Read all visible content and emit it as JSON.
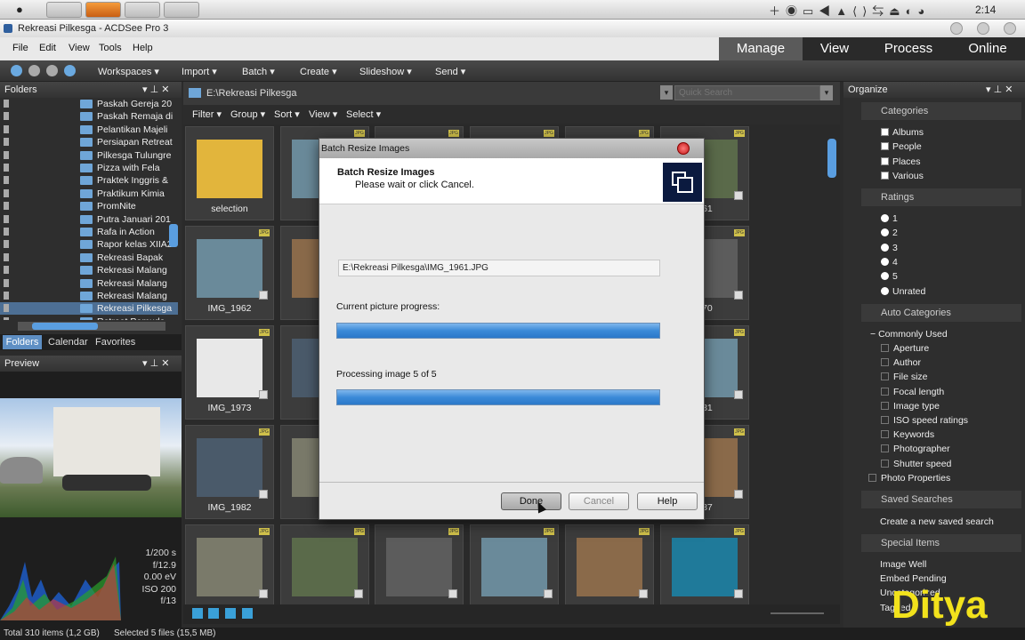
{
  "os": {
    "time": "2:14"
  },
  "window": {
    "title": "Rekreasi Pilkesga - ACDSee Pro 3"
  },
  "menu": [
    "File",
    "Edit",
    "View",
    "Tools",
    "Help"
  ],
  "modes": [
    "Manage",
    "View",
    "Process",
    "Online"
  ],
  "toolbar": [
    "Workspaces",
    "Import",
    "Batch",
    "Create",
    "Slideshow",
    "Send"
  ],
  "folders": {
    "title": "Folders",
    "items": [
      "Paskah Gereja 20",
      "Paskah Remaja di",
      "Pelantikan Majeli",
      "Persiapan Retreat",
      "Pilkesga Tulungre",
      "Pizza with Fela",
      "Praktek Inggris &",
      "Praktikum Kimia",
      "PromNite",
      "Putra Januari 201",
      "Rafa in Action",
      "Rapor kelas XIIA2",
      "Rekreasi Bapak",
      "Rekreasi Malang",
      "Rekreasi Malang",
      "Rekreasi Malang",
      "Rekreasi Pilkesga",
      "Retreat Pemuda"
    ],
    "tabs": [
      "Folders",
      "Calendar",
      "Favorites"
    ]
  },
  "preview": {
    "title": "Preview",
    "info": [
      "1/200 s",
      "f/12.9",
      "0.00 eV",
      "ISO 200",
      "f/13"
    ]
  },
  "browser": {
    "path": "E:\\Rekreasi Pilkesga",
    "search_placeholder": "Quick Search",
    "filters": [
      "Filter",
      "Group",
      "Sort",
      "View",
      "Select"
    ],
    "labels": [
      "selection",
      "IM",
      "961",
      "IMG_1962",
      "IM",
      "970",
      "IMG_1973",
      "IM",
      "981",
      "IMG_1982",
      "IM",
      "987"
    ]
  },
  "organize": {
    "title": "Organize",
    "categories_header": "Categories",
    "categories": [
      "Albums",
      "People",
      "Places",
      "Various"
    ],
    "ratings_header": "Ratings",
    "ratings": [
      "1",
      "2",
      "3",
      "4",
      "5",
      "Unrated"
    ],
    "auto_header": "Auto Categories",
    "common": "Commonly Used",
    "auto": [
      "Aperture",
      "Author",
      "File size",
      "Focal length",
      "Image type",
      "ISO speed ratings",
      "Keywords",
      "Photographer",
      "Shutter speed"
    ],
    "photo_props": "Photo Properties",
    "saved_header": "Saved Searches",
    "saved_new": "Create a new saved search",
    "special_header": "Special Items",
    "special": [
      "Image Well",
      "Embed Pending",
      "Uncategorized",
      "Tagged"
    ]
  },
  "status": {
    "total": "Total 310 items  (1,2 GB)",
    "selected": "Selected 5 files (15,5 MB)"
  },
  "dialog": {
    "title": "Batch Resize Images",
    "heading": "Batch Resize Images",
    "sub": "Please wait or click Cancel.",
    "file": "E:\\Rekreasi Pilkesga\\IMG_1961.JPG",
    "current_label": "Current picture progress:",
    "current_progress": 1.0,
    "processing_label": "Processing image 5 of 5",
    "overall_progress": 1.0,
    "buttons": {
      "done": "Done",
      "cancel": "Cancel",
      "help": "Help"
    }
  },
  "watermark": "Ditya"
}
